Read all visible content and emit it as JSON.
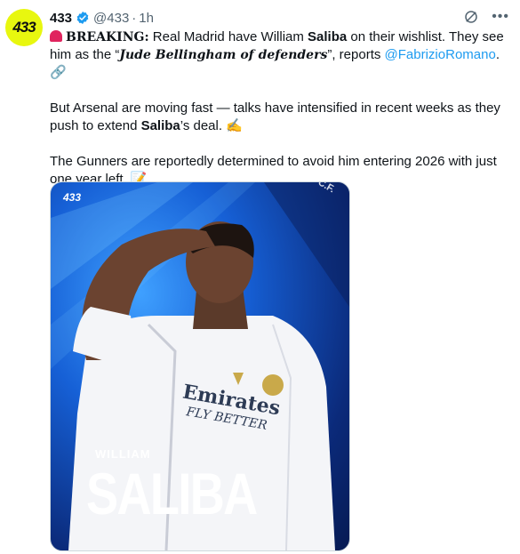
{
  "account": {
    "avatar_text": "433",
    "display_name": "433",
    "handle": "@433",
    "separator": "·",
    "time": "1h"
  },
  "icons": {
    "grok": "grok-icon",
    "more": "more-icon",
    "verified": "verified-badge-icon"
  },
  "tweet": {
    "p1": {
      "breaking": "BREAKING:",
      "t1": " Real Madrid have William ",
      "saliba": "Saliba",
      "t2": " on their wishlist. They see him as the “",
      "quote": "Jude Bellingham of defenders",
      "t3": "”, reports ",
      "mention": "@FabrizioRomano",
      "t4": ". 🔗"
    },
    "p2": {
      "t1": "But Arsenal are moving fast — talks have intensified in recent weeks as they push to extend ",
      "saliba": "Saliba",
      "t2": "’s deal. ✍️"
    },
    "p3": {
      "t1": "The Gunners are reportedly determined to avoid him entering 2026 with just one year left. 📝"
    }
  },
  "media": {
    "brand": "433",
    "club_text": "RID C.F.",
    "sponsor": "Emirates",
    "sponsor_sub": "FLY BETTER",
    "first_name": "WILLIAM",
    "last_name": "SALIBA",
    "colors": {
      "bg_primary": "#1660d6",
      "bg_dark": "#061a52",
      "kit": "#f4f5f8"
    }
  }
}
